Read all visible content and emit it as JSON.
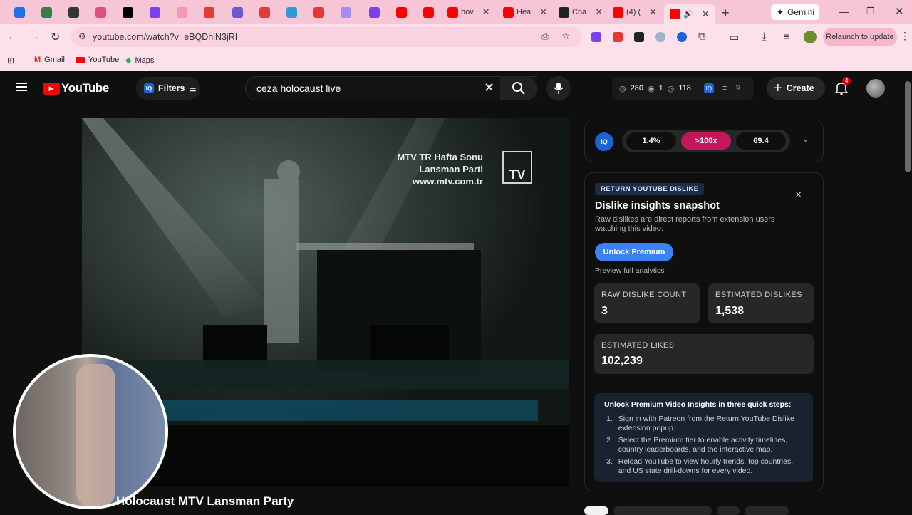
{
  "browser": {
    "tabs": [
      {
        "label": "",
        "color": "#1a73e8"
      },
      {
        "label": "",
        "color": "#3a7d44"
      },
      {
        "label": "",
        "color": "#333333"
      },
      {
        "label": "",
        "color": "#e44d7b"
      },
      {
        "label": "",
        "color": "#000000"
      },
      {
        "label": "",
        "color": "#7b3ff2"
      },
      {
        "label": "",
        "color": "#f09ab3"
      },
      {
        "label": "",
        "color": "#e53935"
      },
      {
        "label": "",
        "color": "#6a5acd"
      },
      {
        "label": "",
        "color": "#e53935"
      },
      {
        "label": "",
        "color": "#2e9bd6"
      },
      {
        "label": "",
        "color": "#e53935"
      },
      {
        "label": "",
        "color": "#a78bfa"
      },
      {
        "label": "",
        "color": "#7b3ff2"
      },
      {
        "label": "",
        "color": "#ff0000"
      },
      {
        "label": "",
        "color": "#ff0000"
      },
      {
        "label": "hov",
        "color": "#ff0000"
      },
      {
        "label": "Hea",
        "color": "#ff0000"
      },
      {
        "label": "Cha",
        "color": "#222222"
      },
      {
        "label": "(4) (",
        "color": "#ff0000"
      }
    ],
    "gemini_tab": "Gemini",
    "url": "youtube.com/watch?v=eBQDhlN3jRI",
    "relaunch": "Relaunch to update",
    "bookmarks": [
      "Gmail",
      "YouTube",
      "Maps"
    ]
  },
  "youtube": {
    "logo": "YouTube",
    "filters": "Filters",
    "search_value": "ceza holocaust live",
    "stats": {
      "time": "280",
      "eye": "1",
      "watched": "118"
    },
    "create": "Create",
    "notifications": "4",
    "video_title": "Holocaust MTV Lansman Party",
    "overlay_line1": "MTV TR Hafta Sonu",
    "overlay_line2": "Lansman Parti",
    "overlay_line3": "www.mtv.com.tr",
    "overlay_logo": "TV"
  },
  "iq_bar": {
    "pill1": "1.4%",
    "pill2": ">100x",
    "pill3": "69.4",
    "accent": "#c2185b"
  },
  "dislike": {
    "badge": "RETURN YOUTUBE DISLIKE",
    "title": "Dislike insights snapshot",
    "desc": "Raw dislikes are direct reports from extension users watching this video.",
    "unlock": "Unlock Premium",
    "preview": "Preview full analytics",
    "raw_label": "RAW DISLIKE COUNT",
    "raw_value": "3",
    "est_dis_label": "ESTIMATED DISLIKES",
    "est_dis_value": "1,538",
    "est_likes_label": "ESTIMATED LIKES",
    "est_likes_value": "102,239",
    "steps_title": "Unlock Premium Video Insights in three quick steps:",
    "steps": [
      "Sign in with Patreon from the Return YouTube Dislike extension popup.",
      "Select the Premium tier to enable activity timelines, country leaderboards, and the interactive map.",
      "Reload YouTube to view hourly trends, top countries, and US state drill-downs for every video."
    ]
  }
}
